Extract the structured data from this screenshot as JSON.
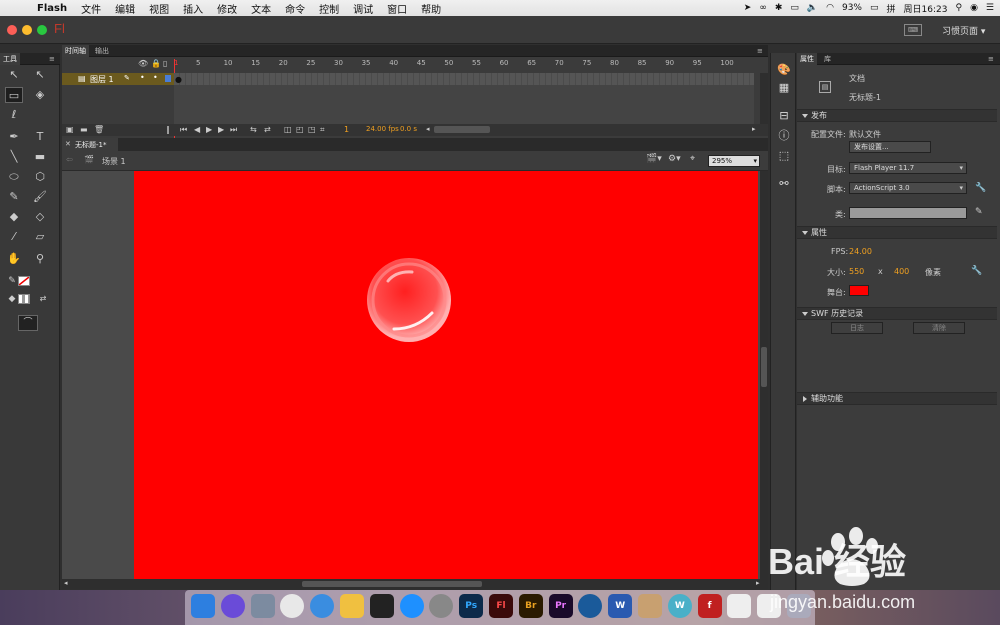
{
  "menubar": {
    "app_name": "Flash",
    "items": [
      "文件",
      "编辑",
      "视图",
      "插入",
      "修改",
      "文本",
      "命令",
      "控制",
      "调试",
      "窗口",
      "帮助"
    ],
    "battery": "93%",
    "clock": "周日16:23"
  },
  "titlebar": {
    "logo": "Fl",
    "workspace": "习惯页面"
  },
  "tools_panel": {
    "title": "工具"
  },
  "timeline": {
    "tabs": [
      "时间轴",
      "输出"
    ],
    "ruler": [
      "1",
      "5",
      "10",
      "15",
      "20",
      "25",
      "30",
      "35",
      "40",
      "45",
      "50",
      "55",
      "60",
      "65",
      "70",
      "75",
      "80",
      "85",
      "90",
      "95",
      "100"
    ],
    "layer_name": "图层 1",
    "current_frame": "1",
    "fps": "24.00 fps",
    "elapsed": "0.0 s"
  },
  "document": {
    "tab_title": "无标题-1*",
    "scene": "场景 1",
    "zoom": "295%"
  },
  "properties": {
    "tabs": [
      "属性",
      "库"
    ],
    "doc_type": "文档",
    "doc_name": "无标题-1",
    "publish": {
      "header": "发布",
      "profile_label": "配置文件:",
      "profile_value": "默认文件",
      "settings_button": "发布设置...",
      "target_label": "目标:",
      "target_value": "Flash Player 11.7",
      "script_label": "脚本:",
      "script_value": "ActionScript 3.0",
      "class_label": "类:"
    },
    "props_section": {
      "header": "属性",
      "fps_label": "FPS:",
      "fps_value": "24.00",
      "size_label": "大小:",
      "width": "550",
      "x_sep": "x",
      "height": "400",
      "unit": "像素",
      "stage_label": "舞台:"
    },
    "swf_history": {
      "header": "SWF 历史记录",
      "log_button": "日志",
      "clear_button": "清除"
    },
    "accessibility": {
      "header": "辅助功能"
    }
  },
  "stage_color": "#ff0000",
  "dock_apps": [
    {
      "name": "finder-icon",
      "label": ""
    },
    {
      "name": "siri-icon",
      "label": ""
    },
    {
      "name": "launchpad-icon",
      "label": ""
    },
    {
      "name": "chrome-icon",
      "label": ""
    },
    {
      "name": "safari-icon",
      "label": ""
    },
    {
      "name": "photos-icon",
      "label": ""
    },
    {
      "name": "qq-icon",
      "label": ""
    },
    {
      "name": "appstore-icon",
      "label": ""
    },
    {
      "name": "system-preferences-icon",
      "label": ""
    },
    {
      "name": "photoshop-icon",
      "label": "Ps"
    },
    {
      "name": "flash-icon",
      "label": "Fl"
    },
    {
      "name": "bridge-icon",
      "label": "Br"
    },
    {
      "name": "premiere-icon",
      "label": "Pr"
    },
    {
      "name": "quicktime-icon",
      "label": ""
    },
    {
      "name": "word-icon",
      "label": "W"
    },
    {
      "name": "archive-icon",
      "label": ""
    },
    {
      "name": "wunderlist-icon",
      "label": "W"
    },
    {
      "name": "flash-player-icon",
      "label": "f"
    },
    {
      "name": "document-icon",
      "label": ""
    },
    {
      "name": "document2-icon",
      "label": ""
    },
    {
      "name": "trash-icon",
      "label": ""
    }
  ],
  "watermark": {
    "brand": "Bai  经验",
    "url": "jingyan.baidu.com"
  }
}
